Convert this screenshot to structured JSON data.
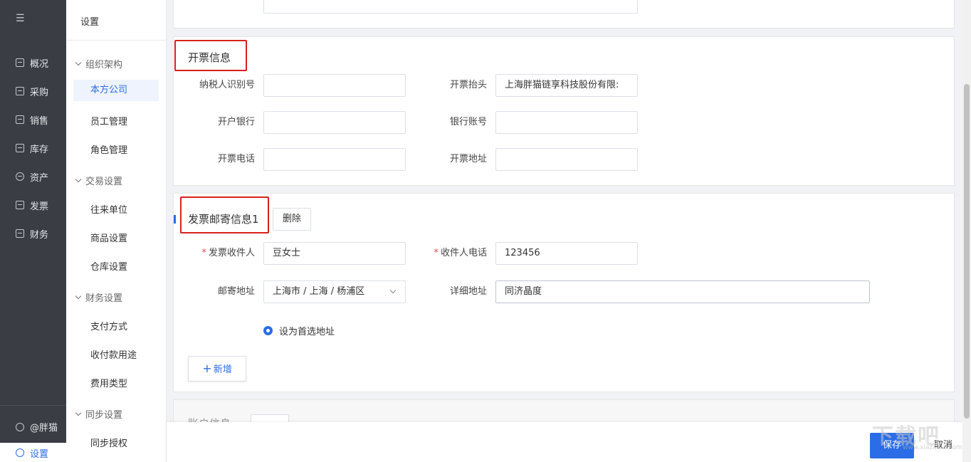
{
  "nav": {
    "items": [
      {
        "label": "概况",
        "icon": "dashboard-icon"
      },
      {
        "label": "采购",
        "icon": "purchase-icon"
      },
      {
        "label": "销售",
        "icon": "sales-icon"
      },
      {
        "label": "库存",
        "icon": "inventory-icon"
      },
      {
        "label": "资产",
        "icon": "asset-icon"
      },
      {
        "label": "发票",
        "icon": "invoice-icon"
      },
      {
        "label": "财务",
        "icon": "finance-icon"
      }
    ],
    "user": "@胖猫",
    "settings": "设置"
  },
  "sidebar": {
    "title": "设置",
    "groups": [
      {
        "label": "组织架构",
        "items": [
          "本方公司",
          "员工管理",
          "角色管理"
        ]
      },
      {
        "label": "交易设置",
        "items": [
          "往来单位",
          "商品设置",
          "仓库设置"
        ]
      },
      {
        "label": "财务设置",
        "items": [
          "支付方式",
          "收付款用途",
          "费用类型"
        ]
      },
      {
        "label": "同步设置",
        "items": [
          "同步授权"
        ]
      }
    ]
  },
  "invoice_info": {
    "title": "开票信息",
    "tax_id_label": "纳税人识别号",
    "tax_id_value": "",
    "header_label": "开票抬头",
    "header_value": "上海胖猫链享科技股份有限:",
    "bank_label": "开户银行",
    "bank_value": "",
    "account_label": "银行账号",
    "account_value": "",
    "phone_label": "开票电话",
    "phone_value": "",
    "address_label": "开票地址",
    "address_value": ""
  },
  "mailing_info": {
    "title": "发票邮寄信息1",
    "delete_label": "删除",
    "recipient_label": "发票收件人",
    "recipient_value": "豆女士",
    "recipient_phone_label": "收件人电话",
    "recipient_phone_value": "123456",
    "region_label": "邮寄地址",
    "region_value": "上海市 / 上海 / 杨浦区",
    "detail_label": "详细地址",
    "detail_value": "同济晶度",
    "default_label": "设为首选地址",
    "add_label": "新增"
  },
  "next_section": {
    "title": "账户信息"
  },
  "footer": {
    "save": "保存",
    "cancel": "取消"
  },
  "watermark": {
    "main": "下载吧",
    "sub": "www.xiazaiba.com"
  },
  "colors": {
    "primary": "#2b6de6",
    "highlight": "#d9221b",
    "nav_bg": "#3a3d44"
  }
}
